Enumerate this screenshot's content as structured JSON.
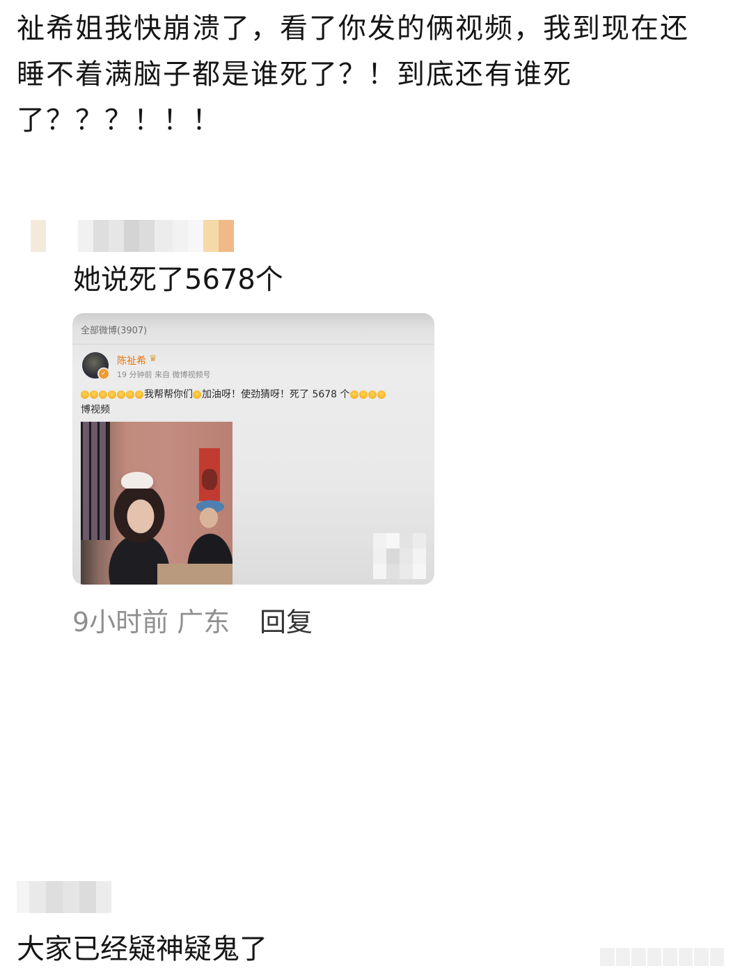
{
  "post": {
    "text": "祉希姐我快崩溃了，看了你发的俩视频，我到现在还睡不着满脑子都是谁死了？！到底还有谁死了？？？！！！"
  },
  "reply": {
    "text": "她说死了5678个",
    "image": {
      "header": "全部微博(3907)",
      "username": "陈祉希",
      "meta": "19 分钟前  来自 微博视频号",
      "weibo_text_mid": "我帮帮你们",
      "weibo_text_end": "加油呀！使劲猜呀！死了 5678 个",
      "weibo_text_line2": "博视频"
    },
    "time_location": "9小时前 广东",
    "reply_label": "回复"
  },
  "comment": {
    "text": "大家已经疑神疑鬼了"
  },
  "colors": {
    "text": "#161616",
    "meta_gray": "#8f8f8f",
    "reply_dark": "#333333",
    "username_orange": "#e8740a"
  }
}
